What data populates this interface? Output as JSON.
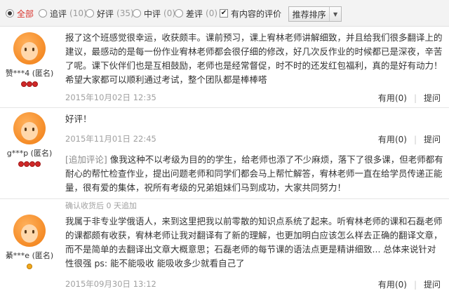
{
  "filters": [
    {
      "label": "全部",
      "count": "",
      "selected": true
    },
    {
      "label": "追评",
      "count": "(10)",
      "selected": false
    },
    {
      "label": "好评",
      "count": "(35)",
      "selected": false
    },
    {
      "label": "中评",
      "count": "(0)",
      "selected": false
    },
    {
      "label": "差评",
      "count": "(0)",
      "selected": false
    }
  ],
  "has_content_filter": {
    "label": "有内容的评价",
    "checked": true,
    "check_glyph": "✔"
  },
  "sort_button": {
    "label": "推荐排序",
    "caret": "▼"
  },
  "actions": {
    "useful": "有用",
    "useful_count": "(0)",
    "ask": "提问"
  },
  "reviews": [
    {
      "user": "赞***4 (匿名)",
      "content": "报了这个班感觉很幸运，收获颇丰。课前预习，课上宥林老师讲解细致，并且给我们很多翻译上的建议，最感动的是每一份作业宥林老师都会很仔细的修改，好几次反作业的时候都已是深夜，辛苦了呢。课下伙伴们也是互相鼓励，老师也是经常督促，时不时的还发红包福利，真的是好有动力！希望大家都可以顺利通过考试，整个团队都是棒棒嗒",
      "date": "2015年10月02日 12:35"
    },
    {
      "user": "g***p (匿名)",
      "content": "好评！",
      "date": "2015年11月01日 22:45",
      "append_tag": "[追加评论]",
      "append_content": "像我这种不以考级为目的的学生，给老师也添了不少麻烦，落下了很多课，但老师都有耐心的帮忙检查作业，提出问题老师和同学们都会马上帮忙解答，宥林老师一直在给学员传递正能量，很有爱的集体，祝所有考级的兄弟姐妹们马到成功，大家共同努力！",
      "append_meta": "确认收货后 0 天追加"
    },
    {
      "user": "綦***e (匿名)",
      "content": "我属于非专业学俄语人，来到这里把我以前零散的知识点系统了起来。听宥林老师的课和石磊老师的课都颇有收获，宥林老师让我对翻译有了新的理解，也更加明白应该怎么样去正确的翻译文章，而不是简单的去翻译出文章大概意思；石磊老师的每节课的语法点更是精讲细致... 总体来说针对性很强 ps: 能不能吸收 能吸收多少就看自己了",
      "date": "2015年09月30日 13:12"
    }
  ]
}
